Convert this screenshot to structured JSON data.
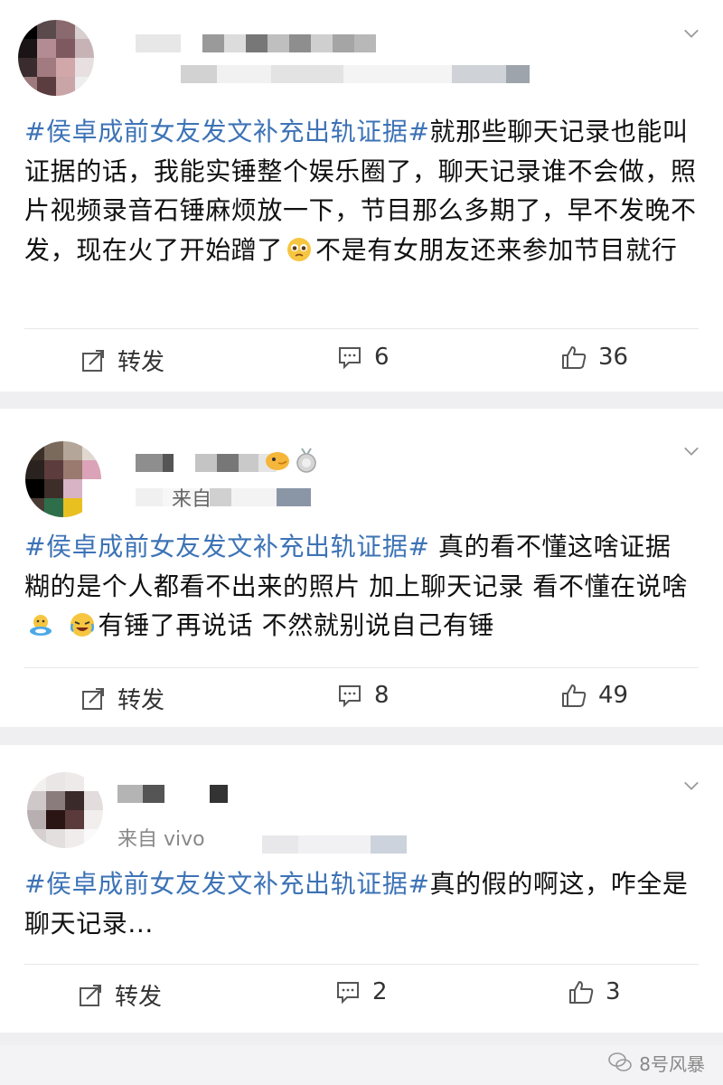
{
  "posts": [
    {
      "content_topic": "#侯卓成前女友发文补充出轨证据#",
      "content_text_a": "就那些聊天记录也能叫证据的话，我能实锤整个娱乐圈了，聊天记录谁不会做，照片视频录音石锤麻烦放一下，节目那么多期了，早不发晚不发，现在火了开始蹭了",
      "content_text_b": "不是有女朋友还来参加节目就行",
      "repost_label": "转发",
      "comment_count": "6",
      "like_count": "36"
    },
    {
      "source_text": "来自",
      "content_topic": "#侯卓成前女友发文补充出轨证据#",
      "content_text_a": " 真的看不懂这啥证据 糊的是个人都看不出来的照片 加上聊天记录 看不懂在说啥 ",
      "content_text_b": "有锤了再说话 不然就别说自己有锤",
      "repost_label": "转发",
      "comment_count": "8",
      "like_count": "49"
    },
    {
      "source_text": "来自 vivo",
      "content_topic": "#侯卓成前女友发文补充出轨证据#",
      "content_text_a": "真的假的啊这，咋全是聊天记录...",
      "repost_label": "转发",
      "comment_count": "2",
      "like_count": "3"
    }
  ],
  "watermark": "8号风暴",
  "icons": {
    "repost": "repost-icon",
    "comment": "comment-icon",
    "like": "like-icon",
    "more": "chevron-down-icon",
    "wechat": "wechat-icon"
  },
  "colors": {
    "topic": "#3d73b6",
    "divider": "#efeff1"
  }
}
